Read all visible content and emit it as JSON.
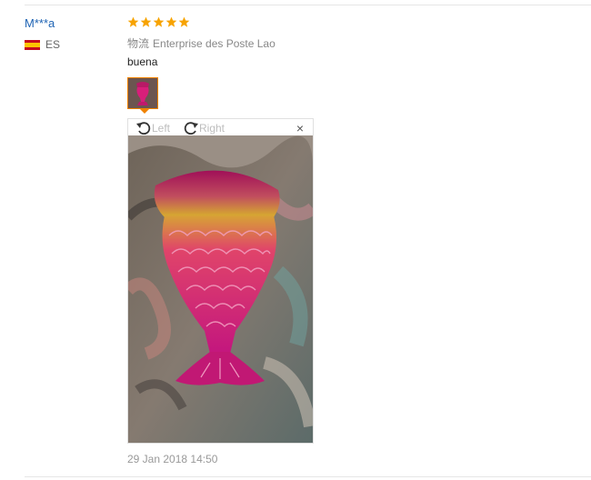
{
  "review": {
    "user_name": "M***a",
    "country_code": "ES",
    "rating": 5,
    "logistics_label": "物流",
    "logistics_value": "Enterprise des Poste Lao",
    "feedback": "buena",
    "date": "29 Jan 2018 14:50"
  },
  "viewer": {
    "rotate_left_label": "Left",
    "rotate_right_label": "Right",
    "close_label": "×"
  },
  "colors": {
    "username": "#1f64b4",
    "star": "#f7a300",
    "thumb_border": "#f08200"
  },
  "icons": [
    "rotate-left-icon",
    "rotate-right-icon",
    "close-icon",
    "star-icon",
    "spain-flag-icon"
  ]
}
